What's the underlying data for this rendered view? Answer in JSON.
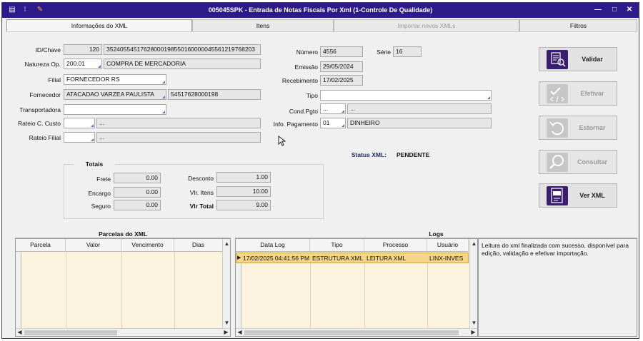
{
  "window": {
    "title": "005045SPK - Entrada de Notas Fiscais Por Xml (1-Controle De Qualidade)",
    "minimize": "—",
    "maximize": "□",
    "close": "✕"
  },
  "tabs": [
    {
      "label": "Informações do XML"
    },
    {
      "label": "Itens"
    },
    {
      "label": "Importar novos XMLs"
    },
    {
      "label": "Filtros"
    }
  ],
  "form": {
    "id_label": "ID/Chave",
    "id_value": "120",
    "chave_value": "35240554517628000198550160000045561219768203",
    "natureza_label": "Natureza Op.",
    "natureza_code": "200.01",
    "natureza_desc": "COMPRA DE MERCADORIA",
    "filial_label": "Filial",
    "filial_value": "FORNECEDOR RS",
    "fornecedor_label": "Fornecedor",
    "fornecedor_value": "ATACADAO VARZEA PAULISTA",
    "fornecedor_cnpj": "54517628000198",
    "transportadora_label": "Transportadora",
    "transportadora_value": "",
    "rateio_custo_label": "Rateio C. Custo",
    "rateio_custo_code": "",
    "rateio_custo_desc": "...",
    "rateio_filial_label": "Rateio Filial",
    "rateio_filial_code": "",
    "rateio_filial_desc": "...",
    "numero_label": "Número",
    "numero_value": "4556",
    "serie_label": "Série",
    "serie_value": "16",
    "emissao_label": "Emissão",
    "emissao_value": "29/05/2024",
    "recebimento_label": "Recebimento",
    "recebimento_value": "17/02/2025",
    "tipo_label": "Tipo",
    "tipo_value": "",
    "condpgto_label": "Cond.Pgto",
    "condpgto_code": "...",
    "condpgto_desc": "...",
    "infopag_label": "Info. Pagamento",
    "infopag_code": "01",
    "infopag_desc": "DINHEIRO",
    "status_label": "Status XML:",
    "status_value": "PENDENTE"
  },
  "totais": {
    "title": "Totais",
    "frete_label": "Frete",
    "frete_value": "0.00",
    "encargo_label": "Encargo",
    "encargo_value": "0.00",
    "seguro_label": "Seguro",
    "seguro_value": "0.00",
    "desconto_label": "Desconto",
    "desconto_value": "1.00",
    "vlritens_label": "Vlr. Itens",
    "vlritens_value": "10.00",
    "vlrtotal_label": "Vlr Total",
    "vlrtotal_value": "9.00"
  },
  "actions": [
    {
      "label": "Validar",
      "icon": "checklist-search-icon",
      "enabled": true
    },
    {
      "label": "Efetivar",
      "icon": "check-code-icon",
      "enabled": false
    },
    {
      "label": "Estornar",
      "icon": "undo-arrow-icon",
      "enabled": false
    },
    {
      "label": "Consultar",
      "icon": "magnifier-icon",
      "enabled": false
    },
    {
      "label": "Ver XML",
      "icon": "xml-file-icon",
      "enabled": true
    }
  ],
  "parcelas": {
    "title": "Parcelas do XML",
    "columns": [
      "Parcela",
      "Valor",
      "Vencimento",
      "Dias"
    ]
  },
  "logs": {
    "title": "Logs",
    "columns": [
      "Data Log",
      "Tipo",
      "Processo",
      "Usuário"
    ],
    "rows": [
      {
        "data": "17/02/2025 04:41:56 PM",
        "tipo": "ESTRUTURA XML C",
        "processo": "LEITURA XML",
        "usuario": "LINX-INVES"
      }
    ],
    "message": "Leitura do xml finalizada com sucesso, disponível para edição, validação e efetivar importação."
  },
  "colors": {
    "titlebar": "#2e1a8a",
    "highlight_row": "#f6d48a",
    "grid_bg": "#fbf3dd",
    "button_icon": "#3b1d6e"
  }
}
